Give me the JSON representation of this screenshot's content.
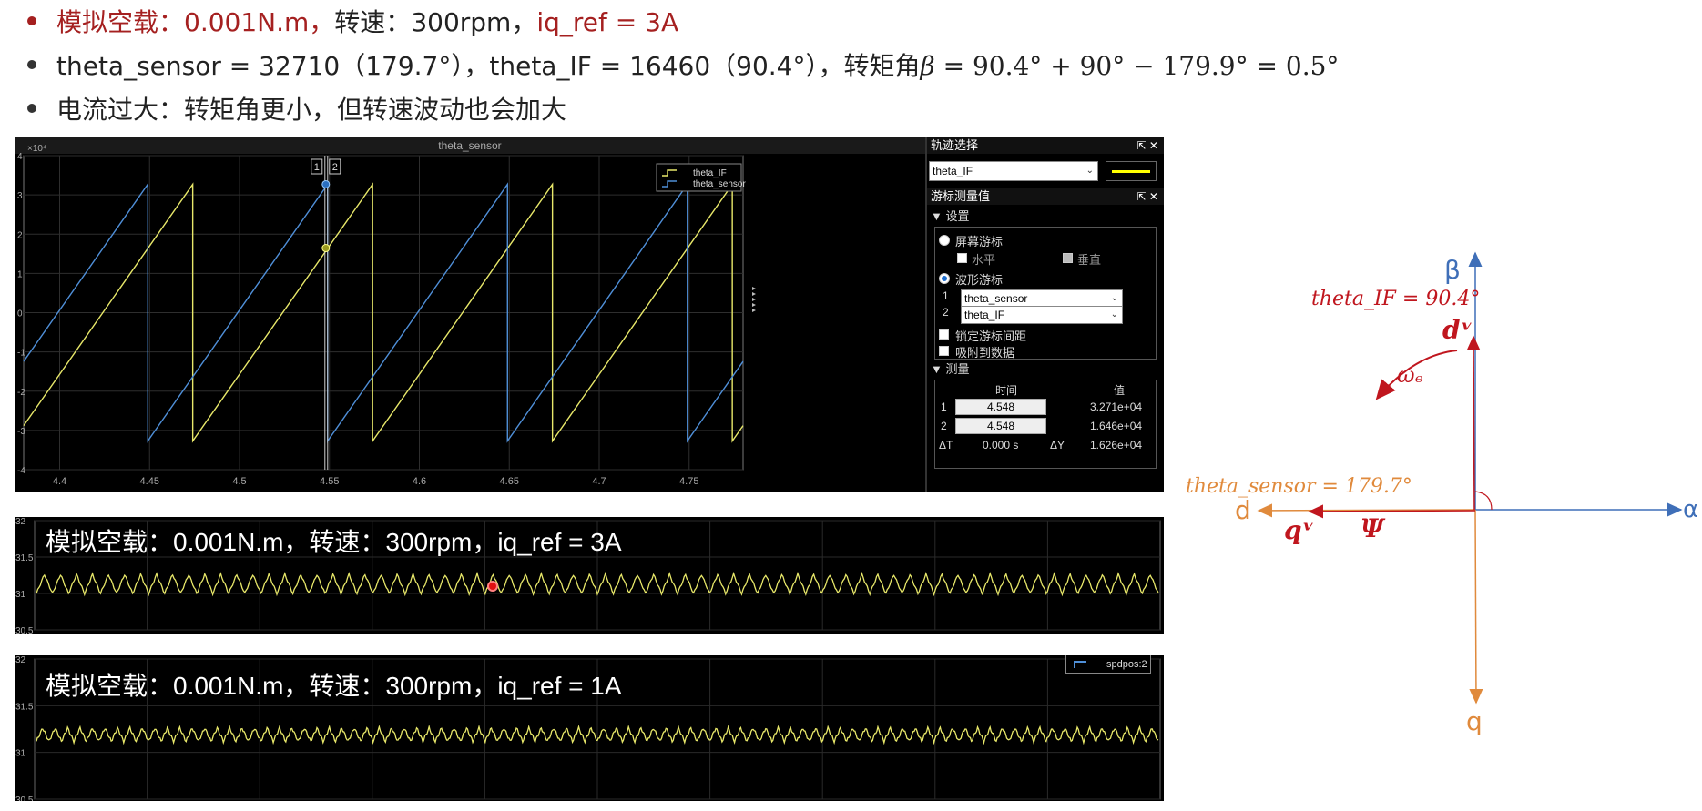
{
  "bullets": {
    "line1": {
      "a": "模拟空载：",
      "b": "0.001N.m，",
      "c": "转速：",
      "d": "300rpm，",
      "e": "iq_ref = 3A"
    },
    "line2": {
      "text": "theta_sensor = 32710（179.7°），theta_IF = 16460（90.4°），转矩角",
      "math_var": "β",
      "math_expr": " = 90.4° + 90° − 179.9° = 0.5°"
    },
    "line3": {
      "text": "电流过大：转矩角更小，但转速波动也会加大"
    }
  },
  "scope": {
    "title": "theta_sensor",
    "exponent": "×10⁴",
    "cursor1": "1",
    "cursor2": "2",
    "legend": [
      "theta_IF",
      "theta_sensor"
    ],
    "colors": {
      "theta_IF": "#e8e86a",
      "theta_sensor": "#4f8fd8"
    }
  },
  "chart_data": {
    "type": "line",
    "title": "theta_sensor",
    "xlim": [
      4.38,
      4.78
    ],
    "ylim": [
      -4,
      4
    ],
    "y_exponent": "×10⁴",
    "x_ticks": [
      "4.4",
      "4.45",
      "4.5",
      "4.55",
      "4.6",
      "4.65",
      "4.7",
      "4.75"
    ],
    "y_ticks": [
      "4",
      "3",
      "2",
      "1",
      "0",
      "-1",
      "-2",
      "-3",
      "-4"
    ],
    "grid": true,
    "legend_position": "top-right",
    "series": [
      {
        "name": "theta_IF",
        "color": "#e8e86a",
        "wraps": [
          4.474,
          4.574,
          4.674,
          4.774
        ],
        "min": -3.27,
        "max": 3.27
      },
      {
        "name": "theta_sensor",
        "color": "#4f8fd8",
        "wraps": [
          4.449,
          4.549,
          4.649,
          4.749
        ],
        "min": -3.27,
        "max": 3.27
      }
    ]
  },
  "panel": {
    "trace_header": "轨迹选择",
    "trace_value": "theta_IF",
    "cursor_header": "游标测量值",
    "settings": "▼ 设置",
    "screen_cursor": "屏幕游标",
    "horizontal": "水平",
    "vertical": "垂直",
    "wave_cursor": "波形游标",
    "c1_index": "1",
    "c2_index": "2",
    "c1_signal": "theta_sensor",
    "c2_signal": "theta_IF",
    "lock_spacing": "锁定游标间距",
    "snap_data": "吸附到数据",
    "measure": "▼ 测量",
    "col_time": "时间",
    "col_value": "值",
    "r1_idx": "1",
    "r1_time": "4.548",
    "r1_value": "3.271e+04",
    "r2_idx": "2",
    "r2_time": "4.548",
    "r2_value": "1.646e+04",
    "dt_label": "ΔT",
    "dt_value": "0.000 s",
    "dy_label": "ΔY",
    "dy_value": "1.626e+04"
  },
  "speed1": {
    "caption": "模拟空载：0.001N.m，转速：300rpm，iq_ref = 3A",
    "y_ticks": [
      "32",
      "31.5",
      "31",
      "30.5"
    ],
    "ylim": [
      30.5,
      32
    ],
    "mean": 31.13,
    "amplitude": 0.13,
    "cycles": 70
  },
  "speed2": {
    "caption": "模拟空载：0.001N.m，转速：300rpm，iq_ref = 1A",
    "legend": "spdpos:2",
    "y_ticks": [
      "32",
      "31.5",
      "31",
      "30.5"
    ],
    "ylim": [
      30.5,
      32
    ],
    "mean": 31.19,
    "amplitude": 0.07,
    "cycles": 90
  },
  "vector": {
    "beta": "β",
    "alpha": "α",
    "d": "d",
    "q": "q",
    "theta_if": "theta_IF = 90.4°",
    "dv": "dᵛ",
    "omega": "ωₑ",
    "theta_sensor": "theta_sensor = 179.7°",
    "qv": "qᵛ",
    "psi": "Ψ",
    "colors": {
      "axes": "#3f6fb8",
      "dq": "#e08a3c",
      "red": "#c0161e"
    }
  }
}
